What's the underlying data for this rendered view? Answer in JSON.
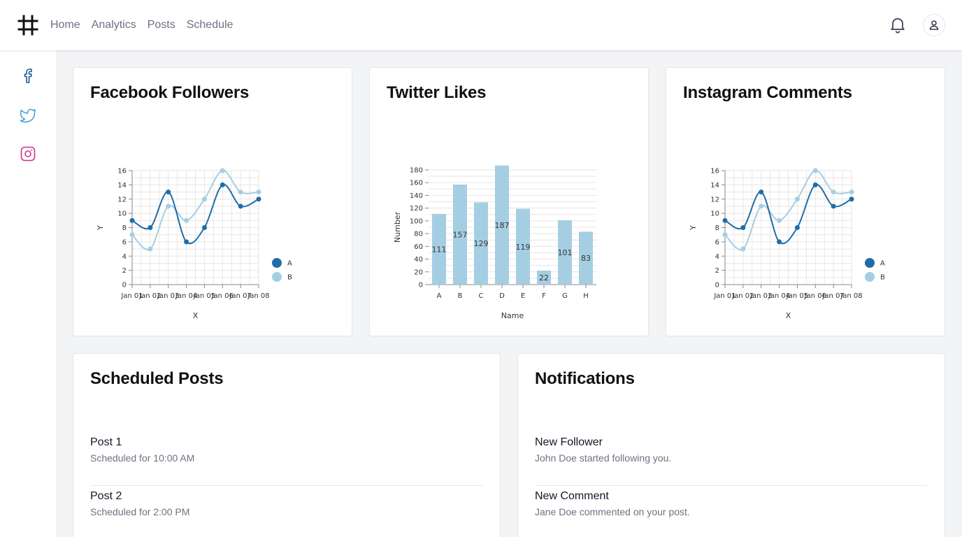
{
  "nav": {
    "brand_icon": "hash-icon",
    "items": [
      {
        "label": "Home"
      },
      {
        "label": "Analytics"
      },
      {
        "label": "Posts"
      },
      {
        "label": "Schedule"
      }
    ],
    "bell_icon": "bell-icon",
    "user_icon": "user-icon"
  },
  "sidebar": {
    "items": [
      {
        "icon": "facebook-icon",
        "color": "#1e5b97"
      },
      {
        "icon": "twitter-icon",
        "color": "#4a9fd8"
      },
      {
        "icon": "instagram-icon",
        "color": "#d0308c"
      }
    ]
  },
  "colors": {
    "series_a": "#1f6da8",
    "series_b": "#a6cee3",
    "bar": "#a6cee3"
  },
  "cards": {
    "facebook_title": "Facebook Followers",
    "twitter_title": "Twitter Likes",
    "instagram_title": "Instagram Comments",
    "scheduled_title": "Scheduled Posts",
    "notifications_title": "Notifications"
  },
  "chart_data": [
    {
      "type": "line",
      "x": [
        "Jan 01",
        "Jan 02",
        "Jan 03",
        "Jan 04",
        "Jan 05",
        "Jan 06",
        "Jan 07",
        "Jan 08"
      ],
      "series": [
        {
          "name": "A",
          "values": [
            9,
            8,
            13,
            6,
            8,
            14,
            11,
            12
          ]
        },
        {
          "name": "B",
          "values": [
            7,
            5,
            11,
            9,
            12,
            16,
            13,
            13
          ]
        }
      ],
      "xlabel": "X",
      "ylabel": "Y",
      "ylim": [
        0,
        16
      ],
      "yticks": [
        0,
        2,
        4,
        6,
        8,
        10,
        12,
        14,
        16
      ],
      "grid": true,
      "legend": "right"
    },
    {
      "type": "bar",
      "categories": [
        "A",
        "B",
        "C",
        "D",
        "E",
        "F",
        "G",
        "H"
      ],
      "values": [
        111,
        157,
        129,
        187,
        119,
        22,
        101,
        83
      ],
      "xlabel": "Name",
      "ylabel": "Number",
      "ylim": [
        0,
        180
      ],
      "yticks": [
        0,
        20,
        40,
        60,
        80,
        100,
        120,
        140,
        160,
        180
      ],
      "grid": true
    },
    {
      "type": "line",
      "x": [
        "Jan 01",
        "Jan 02",
        "Jan 03",
        "Jan 04",
        "Jan 05",
        "Jan 06",
        "Jan 07",
        "Jan 08"
      ],
      "series": [
        {
          "name": "A",
          "values": [
            9,
            8,
            13,
            6,
            8,
            14,
            11,
            12
          ]
        },
        {
          "name": "B",
          "values": [
            7,
            5,
            11,
            9,
            12,
            16,
            13,
            13
          ]
        }
      ],
      "xlabel": "X",
      "ylabel": "Y",
      "ylim": [
        0,
        16
      ],
      "yticks": [
        0,
        2,
        4,
        6,
        8,
        10,
        12,
        14,
        16
      ],
      "grid": true,
      "legend": "right"
    }
  ],
  "scheduled_posts": [
    {
      "title": "Post 1",
      "subtitle": "Scheduled for 10:00 AM"
    },
    {
      "title": "Post 2",
      "subtitle": "Scheduled for 2:00 PM"
    }
  ],
  "notifications": [
    {
      "title": "New Follower",
      "subtitle": "John Doe started following you."
    },
    {
      "title": "New Comment",
      "subtitle": "Jane Doe commented on your post."
    }
  ]
}
